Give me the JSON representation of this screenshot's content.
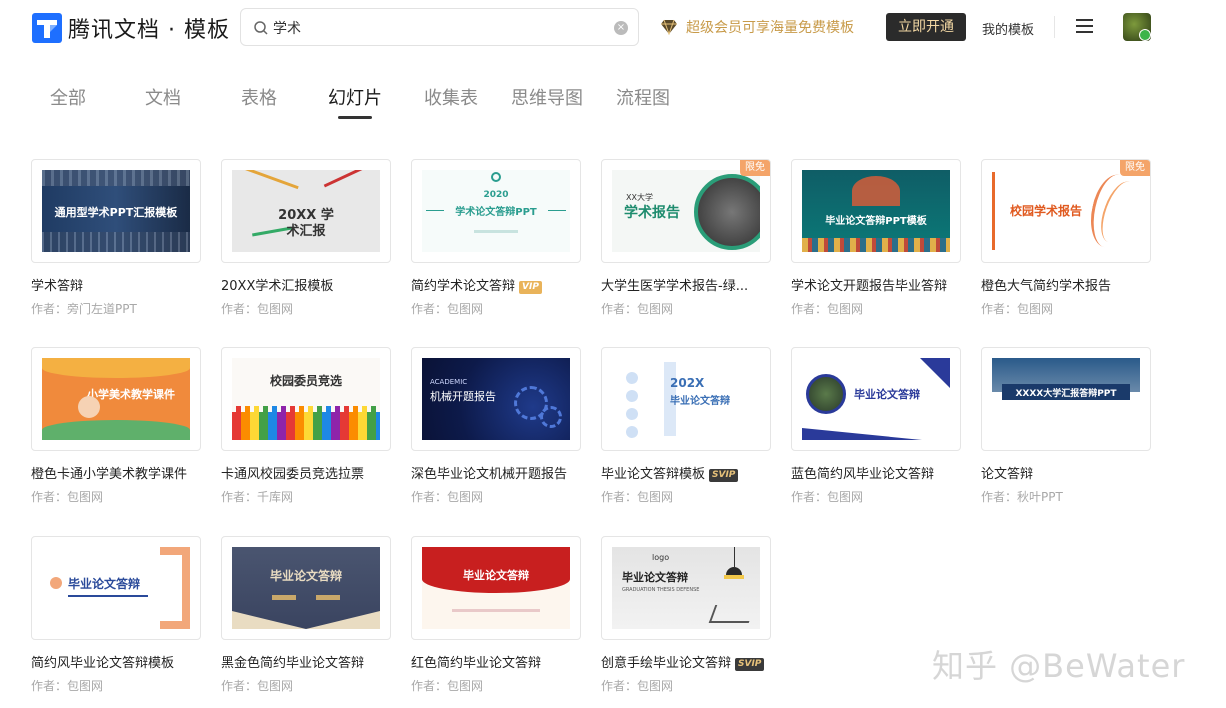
{
  "header": {
    "logo_text": "腾讯文档 · 模板",
    "search_value": "学术",
    "vip_promo": "超级会员可享海量免费模板",
    "open_button": "立即开通",
    "my_templates": "我的模板"
  },
  "tabs": [
    {
      "label": "全部",
      "active": false
    },
    {
      "label": "文档",
      "active": false
    },
    {
      "label": "表格",
      "active": false
    },
    {
      "label": "幻灯片",
      "active": true
    },
    {
      "label": "收集表",
      "active": false
    },
    {
      "label": "思维导图",
      "active": false
    },
    {
      "label": "流程图",
      "active": false
    }
  ],
  "badges": {
    "free": "限免",
    "vip": "VIP",
    "svip": "SVIP"
  },
  "cards": [
    {
      "title": "学术答辩",
      "author": "作者：旁门左道PPT",
      "thumb_text": "通用型学术PPT汇报模板"
    },
    {
      "title": "20XX学术汇报模板",
      "author": "作者：包图网",
      "thumb_text": "20XX 学术汇报"
    },
    {
      "title": "简约学术论文答辩",
      "author": "作者：包图网",
      "thumb_text": "学术论文答辩PPT",
      "thumb_sub": "2020"
    },
    {
      "title": "大学生医学学术报告-绿...",
      "author": "作者：包图网",
      "thumb_text": "学术报告",
      "thumb_sub": "XX大学"
    },
    {
      "title": "学术论文开题报告毕业答辩",
      "author": "作者：包图网",
      "thumb_text": "毕业论文答辩PPT模板"
    },
    {
      "title": "橙色大气简约学术报告",
      "author": "作者：包图网",
      "thumb_text": "校园学术报告"
    },
    {
      "title": "橙色卡通小学美术教学课件",
      "author": "作者：包图网",
      "thumb_text": "小学美术教学课件"
    },
    {
      "title": "卡通风校园委员竞选拉票",
      "author": "作者：千库网",
      "thumb_text": "校园委员竞选"
    },
    {
      "title": "深色毕业论文机械开题报告",
      "author": "作者：包图网",
      "thumb_text": "机械开题报告",
      "thumb_sub": "ACADEMIC"
    },
    {
      "title": "毕业论文答辩模板",
      "author": "作者：包图网",
      "thumb_text": "毕业论文答辩",
      "thumb_sub": "202X"
    },
    {
      "title": "蓝色简约风毕业论文答辩",
      "author": "作者：包图网",
      "thumb_text": "毕业论文答辩"
    },
    {
      "title": "论文答辩",
      "author": "作者：秋叶PPT",
      "thumb_text": "XXXX大学汇报答辩PPT"
    },
    {
      "title": "简约风毕业论文答辩模板",
      "author": "作者：包图网",
      "thumb_text": "毕业论文答辩"
    },
    {
      "title": "黑金色简约毕业论文答辩",
      "author": "作者：包图网",
      "thumb_text": "毕业论文答辩"
    },
    {
      "title": "红色简约毕业论文答辩",
      "author": "作者：包图网",
      "thumb_text": "毕业论文答辩"
    },
    {
      "title": "创意手绘毕业论文答辩",
      "author": "作者：包图网",
      "thumb_text": "毕业论文答辩",
      "thumb_sub": "GRADUATION THESIS DEFENSE",
      "thumb_logo": "logo"
    }
  ],
  "watermark": "知乎 @BeWater",
  "colors": {
    "accent_gold": "#c89b4a",
    "free_badge": "#f4a469",
    "dark_button": "#2b2b2b"
  }
}
